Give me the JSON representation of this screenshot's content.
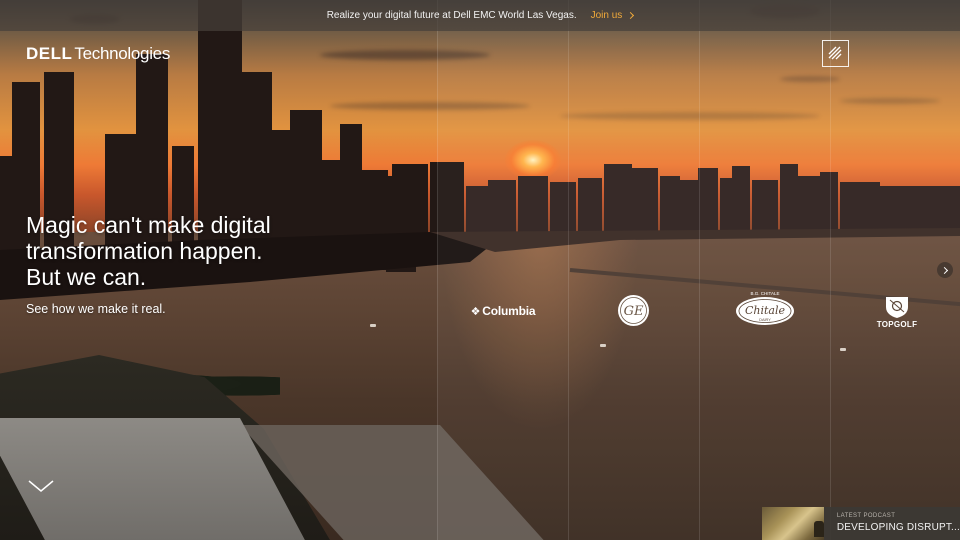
{
  "banner": {
    "message": "Realize your digital future at Dell EMC World Las Vegas.",
    "join_label": "Join us"
  },
  "logo": {
    "brand": "DELL",
    "suffix": "Technologies"
  },
  "hero": {
    "title_lines": [
      "Magic can't make digital",
      "transformation happen.",
      "But we can."
    ],
    "subtitle": "See how we make it real."
  },
  "clients": {
    "columbia": "Columbia",
    "chitale_top": "B.G. CHITALE",
    "chitale_script": "Chitale",
    "chitale_bottom": "DAIRY",
    "topgolf": "TOPGOLF"
  },
  "podcast": {
    "kicker": "LATEST PODCAST",
    "title": "DEVELOPING DISRUPT..."
  },
  "icons": {
    "menu": "hamburger-diagonal-icon",
    "next": "chevron-right-icon",
    "scroll": "chevron-down-icon"
  },
  "colors": {
    "accent": "#f0a93a",
    "banner_bg": "#46403a"
  }
}
